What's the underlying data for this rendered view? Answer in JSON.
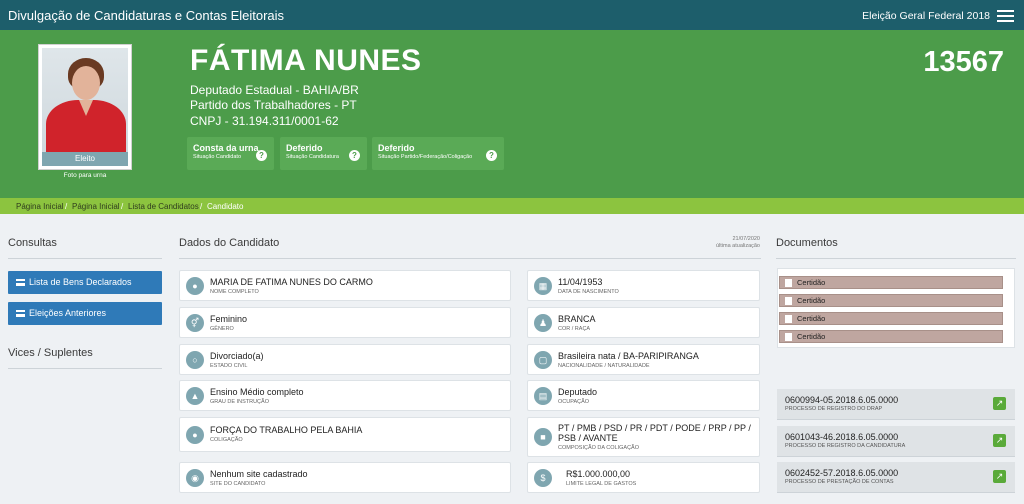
{
  "topbar": {
    "title": "Divulgação de Candidaturas e Contas Eleitorais",
    "election": "Eleição Geral Federal 2018",
    "menu_icon": "hamburger-icon"
  },
  "candidate": {
    "name": "FÁTIMA NUNES",
    "office": "Deputado Estadual - BAHIA/BR",
    "party": "Partido dos Trabalhadores - PT",
    "cnpj": "CNPJ - 31.194.311/0001-62",
    "number": "13567",
    "photo_status": "Eleito",
    "photo_caption": "Foto para urna"
  },
  "status_pills": [
    {
      "main": "Consta da urna",
      "sub": "Situação Candidato",
      "icon": "question-icon"
    },
    {
      "main": "Deferido",
      "sub": "Situação Candidatura",
      "icon": "question-icon"
    },
    {
      "main": "Deferido",
      "sub": "Situação Partido/Federação/Coligação",
      "icon": "question-icon"
    }
  ],
  "breadcrumb": [
    "Página Inicial",
    "Página Inicial",
    "Lista de Candidatos",
    "Candidato"
  ],
  "left": {
    "consultas_title": "Consultas",
    "buttons": [
      "Lista de Bens Declarados",
      "Eleições Anteriores"
    ],
    "vices_title": "Vices / Suplentes"
  },
  "dados": {
    "title": "Dados do Candidato",
    "updated_date": "21/07/2020",
    "updated_label": "última atualização",
    "left_col": [
      {
        "value": "MARIA DE FATIMA NUNES DO CARMO",
        "label": "NOME COMPLETO",
        "icon": "user-icon"
      },
      {
        "value": "Feminino",
        "label": "GÊNERO",
        "icon": "gender-icon"
      },
      {
        "value": "Divorciado(a)",
        "label": "ESTADO CIVIL",
        "icon": "ring-icon"
      },
      {
        "value": "Ensino Médio completo",
        "label": "GRAU DE INSTRUÇÃO",
        "icon": "graduation-cap-icon"
      },
      {
        "value": "FORÇA DO TRABALHO PELA BAHIA",
        "label": "COLIGAÇÃO",
        "icon": "users-icon"
      },
      {
        "value": "Nenhum site cadastrado",
        "label": "SITE DO CANDIDATO",
        "icon": "globe-icon"
      }
    ],
    "right_col": [
      {
        "value": "11/04/1953",
        "label": "DATA DE NASCIMENTO",
        "icon": "calendar-icon"
      },
      {
        "value": "BRANCA",
        "label": "COR / RAÇA",
        "icon": "person-icon"
      },
      {
        "value": "Brasileira nata / BA-PARIPIRANGA",
        "label": "NACIONALIDADE / NATURALIDADE",
        "icon": "map-icon"
      },
      {
        "value": "Deputado",
        "label": "OCUPAÇÃO",
        "icon": "building-icon"
      },
      {
        "value": "PT / PMB / PSD / PR / PDT / PODE / PRP / PP / PSB / AVANTE",
        "label": "COMPOSIÇÃO DA COLIGAÇÃO",
        "icon": "folder-icon"
      },
      {
        "value": "R$1.000.000,00",
        "label": "LIMITE LEGAL DE GASTOS",
        "icon": "dollar-icon"
      }
    ]
  },
  "documentos": {
    "title": "Documentos",
    "certidoes": [
      "Certidão",
      "Certidão",
      "Certidão",
      "Certidão"
    ],
    "processos": [
      {
        "number": "0600994-05.2018.6.05.0000",
        "label": "PROCESSO DE REGISTRO DO DRAP"
      },
      {
        "number": "0601043-46.2018.6.05.0000",
        "label": "PROCESSO DE REGISTRO DA CANDIDATURA"
      },
      {
        "number": "0602452-57.2018.6.05.0000",
        "label": "PROCESSO DE PRESTAÇÃO DE CONTAS"
      }
    ]
  },
  "colors": {
    "topbar": "#1d5e6b",
    "hero": "#4c9c4a",
    "breadcrumb": "#8cc43f",
    "button": "#2f7ab8"
  }
}
